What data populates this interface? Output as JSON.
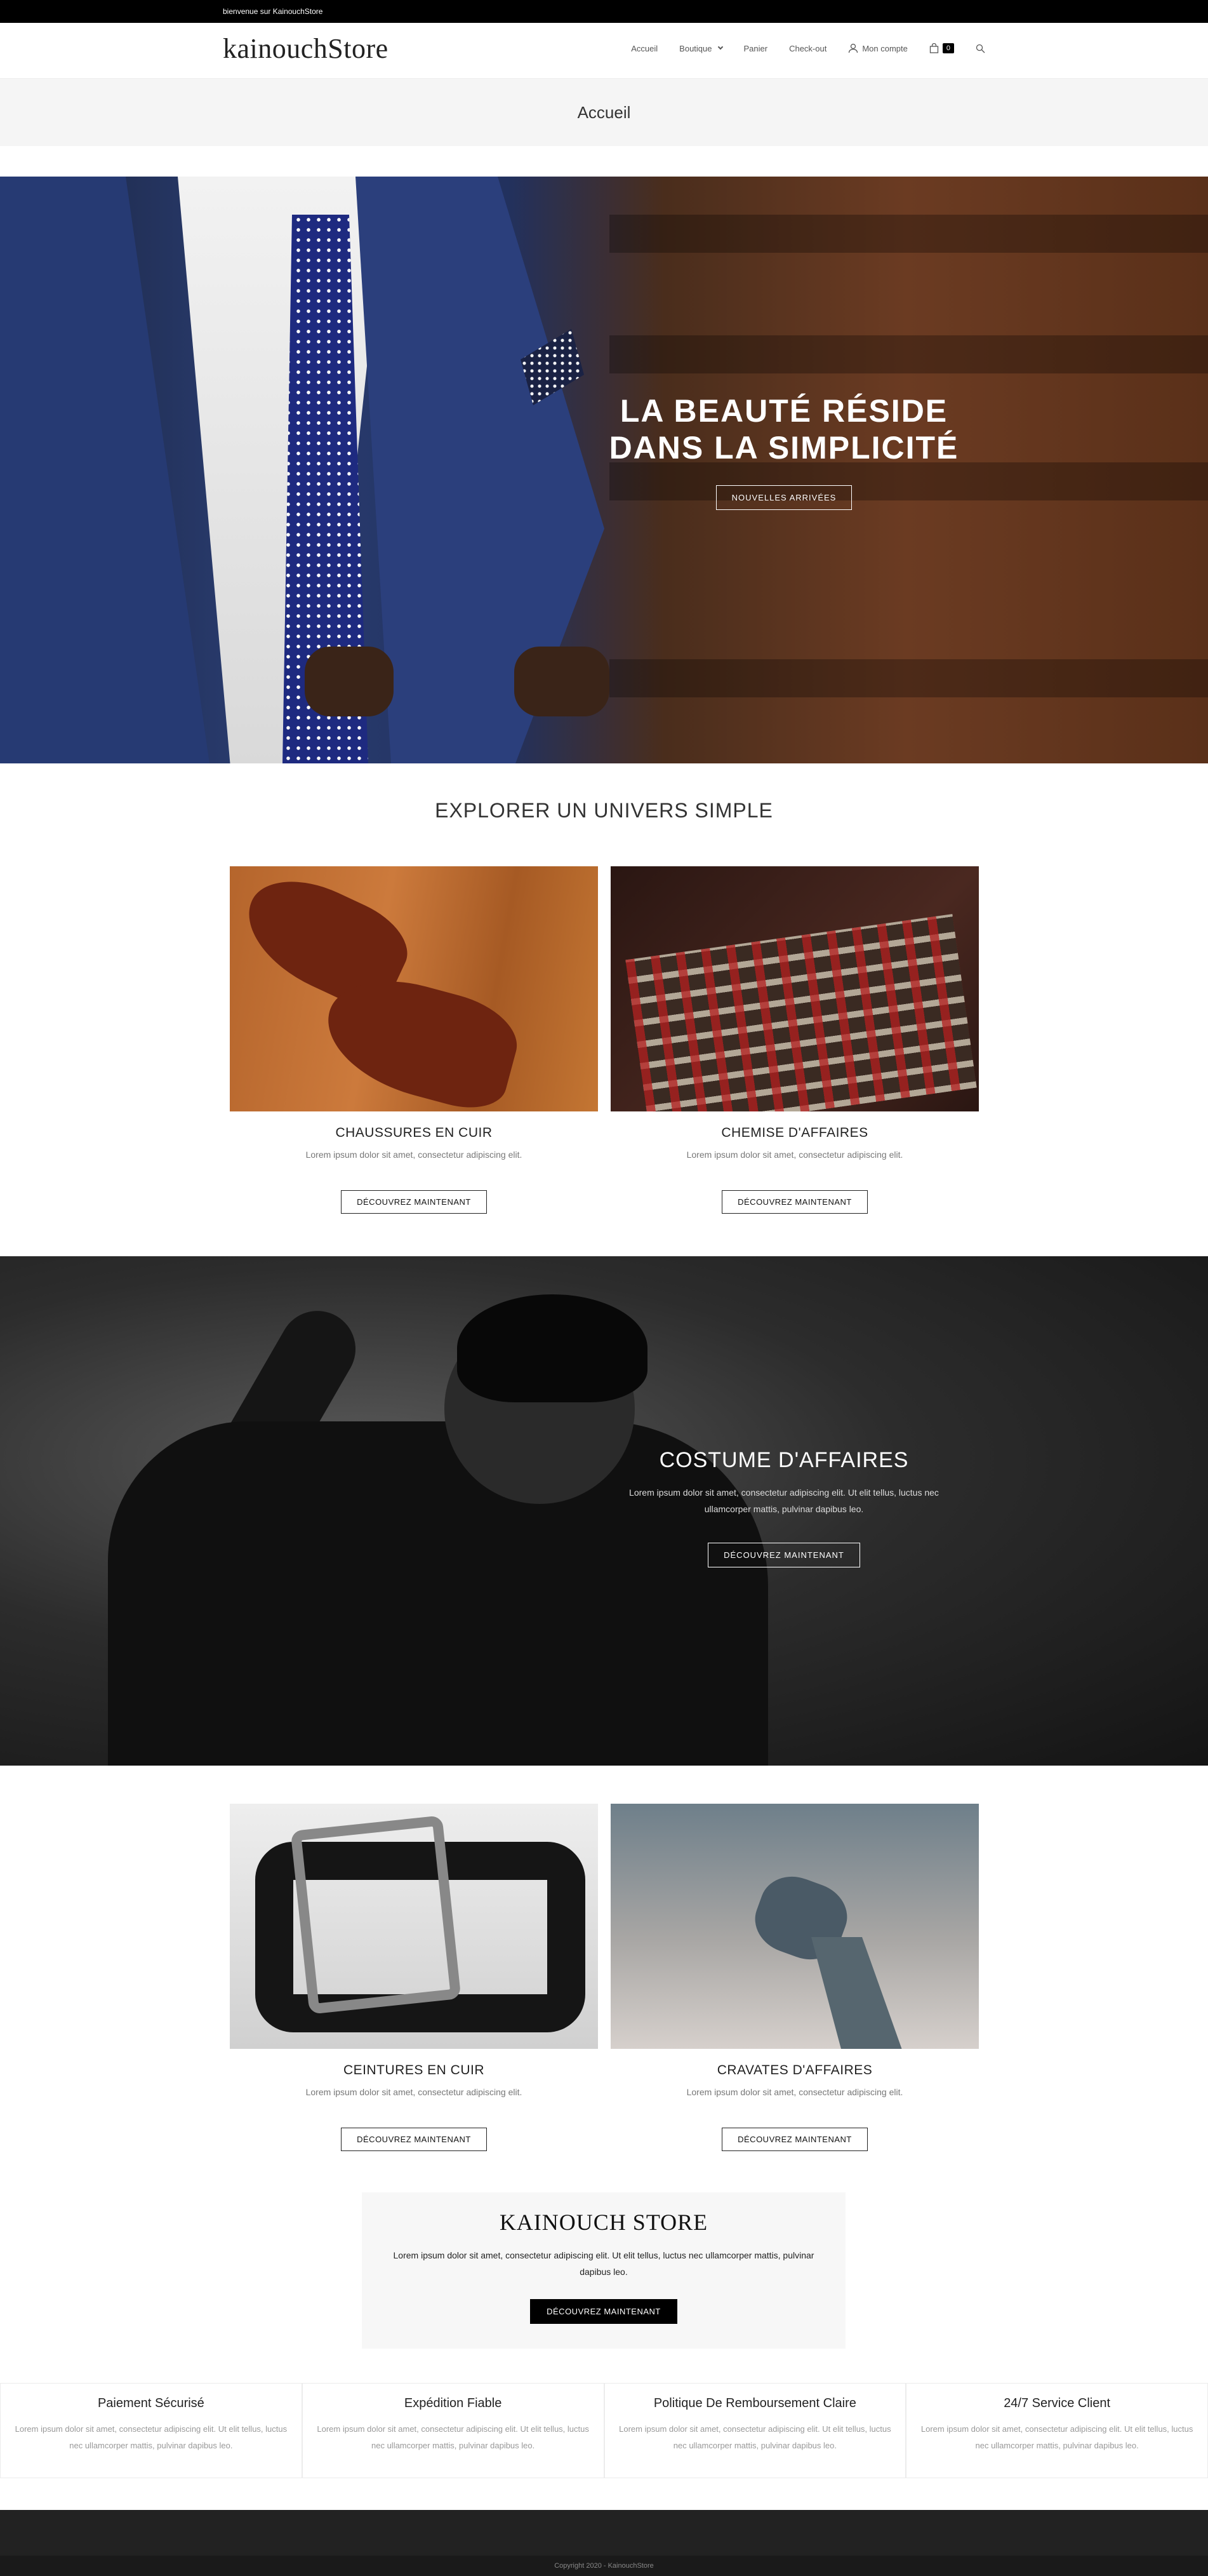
{
  "topbar": {
    "welcome": "bienvenue sur KainouchStore"
  },
  "header": {
    "logo": "kainouchStore",
    "nav": [
      {
        "label": "Accueil"
      },
      {
        "label": "Boutique"
      },
      {
        "label": "Panier"
      },
      {
        "label": "Check-out"
      },
      {
        "label": "Mon compte",
        "icon": "user-icon"
      }
    ],
    "cart_count": "0",
    "icons": [
      "user-icon",
      "shopping-bag-icon",
      "search-icon",
      "chevron-down-icon"
    ]
  },
  "page_title": "Accueil",
  "hero": {
    "heading": "LA BEAUTÉ RÉSIDE DANS LA SIMPLICITÉ",
    "button": "NOUVELLES ARRIVÉES"
  },
  "explore": {
    "title": "EXPLORER UN UNIVERS SIMPLE"
  },
  "products": [
    {
      "title": "CHAUSSURES EN CUIR",
      "desc": "Lorem ipsum dolor sit amet, consectetur adipiscing elit.",
      "button": "DÉCOUVREZ MAINTENANT"
    },
    {
      "title": "CHEMISE D'AFFAIRES",
      "desc": "Lorem ipsum dolor sit amet, consectetur adipiscing elit.",
      "button": "DÉCOUVREZ MAINTENANT"
    },
    {
      "title": "CEINTURES EN CUIR",
      "desc": "Lorem ipsum dolor sit amet, consectetur adipiscing elit.",
      "button": "DÉCOUVREZ MAINTENANT"
    },
    {
      "title": "CRAVATES D'AFFAIRES",
      "desc": "Lorem ipsum dolor sit amet, consectetur adipiscing elit.",
      "button": "DÉCOUVREZ MAINTENANT"
    }
  ],
  "suit": {
    "title": "COSTUME D'AFFAIRES",
    "desc": "Lorem ipsum dolor sit amet, consectetur adipiscing elit. Ut elit tellus, luctus nec ullamcorper mattis, pulvinar dapibus leo.",
    "button": "DÉCOUVREZ MAINTENANT"
  },
  "promo": {
    "title": "KAINOUCH STORE",
    "desc": "Lorem ipsum dolor sit amet, consectetur adipiscing elit. Ut elit tellus, luctus nec ullamcorper mattis, pulvinar dapibus leo.",
    "button": "DÉCOUVREZ MAINTENANT"
  },
  "features": [
    {
      "title": "Paiement Sécurisé",
      "desc": "Lorem ipsum dolor sit amet, consectetur adipiscing elit. Ut elit tellus, luctus nec ullamcorper mattis, pulvinar dapibus leo."
    },
    {
      "title": "Expédition Fiable",
      "desc": "Lorem ipsum dolor sit amet, consectetur adipiscing elit. Ut elit tellus, luctus nec ullamcorper mattis, pulvinar dapibus leo."
    },
    {
      "title": "Politique De Remboursement Claire",
      "desc": "Lorem ipsum dolor sit amet, consectetur adipiscing elit. Ut elit tellus, luctus nec ullamcorper mattis, pulvinar dapibus leo."
    },
    {
      "title": "24/7 Service Client",
      "desc": "Lorem ipsum dolor sit amet, consectetur adipiscing elit. Ut elit tellus, luctus nec ullamcorper mattis, pulvinar dapibus leo."
    }
  ],
  "footer": {
    "copyright": "Copyright 2020 - KainouchStore"
  },
  "colors": {
    "accent": "#000000",
    "title_bar": "#f5f5f5",
    "footer": "#222222"
  }
}
